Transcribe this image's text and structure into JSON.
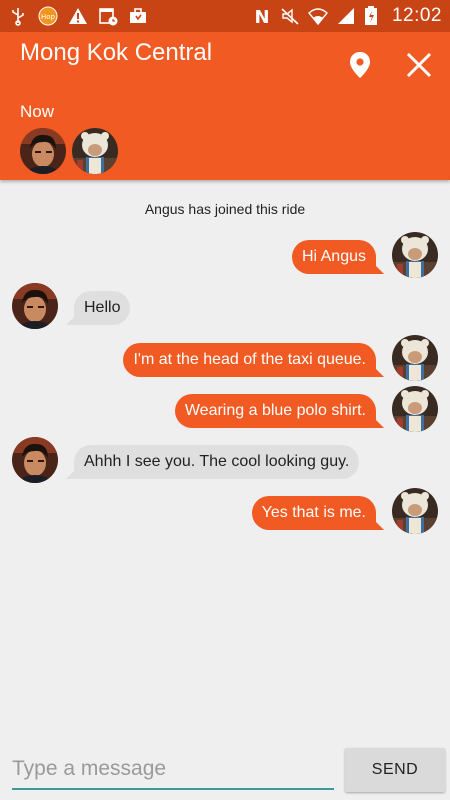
{
  "status_bar": {
    "time": "12:02",
    "left_icons": [
      "usb-icon",
      "app-badge-icon",
      "warning-icon",
      "calendar-clock-icon",
      "briefcase-icon"
    ],
    "right_icons": [
      "nfc-icon",
      "mute-icon",
      "wifi-icon",
      "signal-icon",
      "battery-icon"
    ]
  },
  "header": {
    "title": "Mong Kok Central",
    "subtitle": "Now",
    "participants": [
      "participant-dark-hair",
      "participant-white-fur-hat"
    ],
    "accent_color": "#f15a22"
  },
  "chat": {
    "system_message": "Angus has joined this ride",
    "messages": [
      {
        "from": "me",
        "text": "Hi Angus"
      },
      {
        "from": "them",
        "text": "Hello"
      },
      {
        "from": "me",
        "text": "I'm at the head of the taxi queue."
      },
      {
        "from": "me",
        "text": "Wearing a blue polo shirt."
      },
      {
        "from": "them",
        "text": "Ahhh I see you. The cool looking guy."
      },
      {
        "from": "me",
        "text": "Yes that is me."
      }
    ]
  },
  "composer": {
    "placeholder": "Type a message",
    "value": "",
    "send_label": "SEND"
  }
}
